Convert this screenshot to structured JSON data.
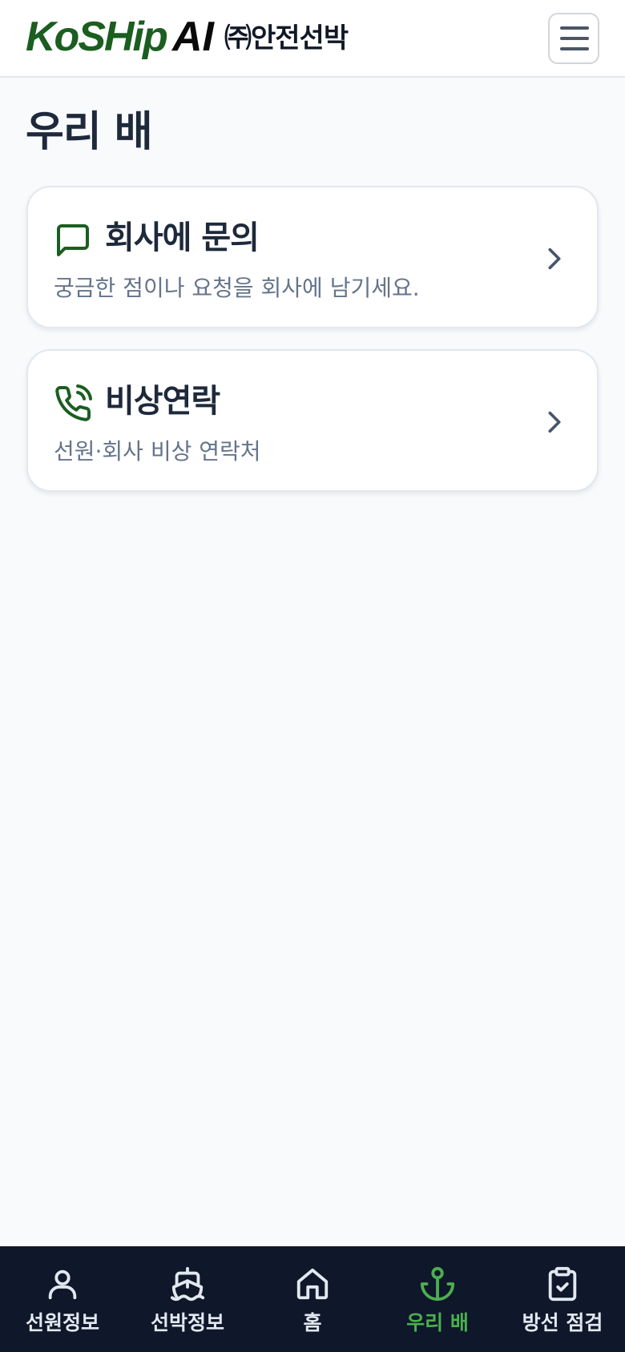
{
  "header": {
    "logo_text": "KoSHip",
    "logo_ai": "AI",
    "company_name": "㈜안전선박",
    "menu_icon": "hamburger-menu-icon"
  },
  "page": {
    "title": "우리 배"
  },
  "cards": [
    {
      "icon": "message-square-icon",
      "title": "회사에 문의",
      "description": "궁금한 점이나 요청을 회사에 남기세요."
    },
    {
      "icon": "phone-call-icon",
      "title": "비상연락",
      "description": "선원·회사 비상 연락처"
    }
  ],
  "bottom_nav": {
    "items": [
      {
        "label": "선원정보",
        "icon": "user-icon",
        "active": false
      },
      {
        "label": "선박정보",
        "icon": "ship-icon",
        "active": false
      },
      {
        "label": "홈",
        "icon": "home-icon",
        "active": false
      },
      {
        "label": "우리 배",
        "icon": "anchor-icon",
        "active": true
      },
      {
        "label": "방선 점검",
        "icon": "clipboard-check-icon",
        "active": false
      }
    ]
  },
  "colors": {
    "brand_green": "#1b5e20",
    "accent_green": "#4caf50",
    "nav_background": "#0f172a",
    "page_background": "#f8fafc"
  }
}
